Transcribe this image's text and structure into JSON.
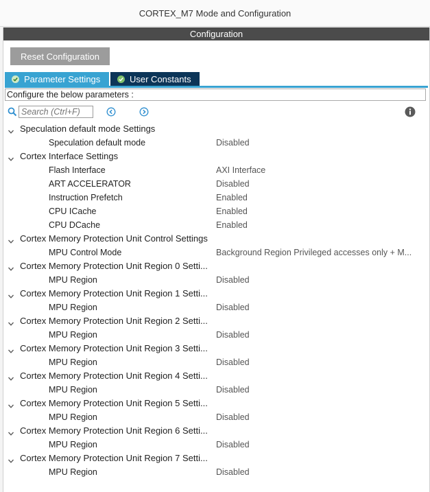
{
  "window": {
    "title": "CORTEX_M7 Mode and Configuration"
  },
  "configuration": {
    "header": "Configuration",
    "reset_button": "Reset Configuration",
    "tabs": [
      {
        "label": "Parameter Settings",
        "active": true
      },
      {
        "label": "User Constants",
        "active": false
      }
    ],
    "description": "Configure the below parameters :",
    "search": {
      "placeholder": "Search (Ctrl+F)",
      "value": ""
    },
    "icons": {
      "search": "search-icon",
      "prev": "chevron-left-circle-icon",
      "next": "chevron-right-circle-icon",
      "info": "info-icon",
      "tab_check": "check-circle-icon",
      "expand": "chevron-down-icon"
    }
  },
  "tree": {
    "groups": [
      {
        "label": "Speculation default mode Settings",
        "params": [
          {
            "label": "Speculation default mode",
            "value": "Disabled"
          }
        ]
      },
      {
        "label": "Cortex Interface Settings",
        "params": [
          {
            "label": "Flash Interface",
            "value": "AXI Interface"
          },
          {
            "label": "ART ACCELERATOR",
            "value": "Disabled"
          },
          {
            "label": "Instruction Prefetch",
            "value": "Enabled"
          },
          {
            "label": "CPU ICache",
            "value": "Enabled"
          },
          {
            "label": "CPU DCache",
            "value": "Enabled"
          }
        ]
      },
      {
        "label": "Cortex Memory Protection Unit Control Settings",
        "params": [
          {
            "label": "MPU Control Mode",
            "value": "Background Region Privileged accesses only + M..."
          }
        ]
      },
      {
        "label": "Cortex Memory Protection Unit Region 0 Setti...",
        "params": [
          {
            "label": "MPU Region",
            "value": "Disabled"
          }
        ]
      },
      {
        "label": "Cortex Memory Protection Unit Region 1 Setti...",
        "params": [
          {
            "label": "MPU Region",
            "value": "Disabled"
          }
        ]
      },
      {
        "label": "Cortex Memory Protection Unit Region 2 Setti...",
        "params": [
          {
            "label": "MPU Region",
            "value": "Disabled"
          }
        ]
      },
      {
        "label": "Cortex Memory Protection Unit Region 3 Setti...",
        "params": [
          {
            "label": "MPU Region",
            "value": "Disabled"
          }
        ]
      },
      {
        "label": "Cortex Memory Protection Unit Region 4 Setti...",
        "params": [
          {
            "label": "MPU Region",
            "value": "Disabled"
          }
        ]
      },
      {
        "label": "Cortex Memory Protection Unit Region 5 Setti...",
        "params": [
          {
            "label": "MPU Region",
            "value": "Disabled"
          }
        ]
      },
      {
        "label": "Cortex Memory Protection Unit Region 6 Setti...",
        "params": [
          {
            "label": "MPU Region",
            "value": "Disabled"
          }
        ]
      },
      {
        "label": "Cortex Memory Protection Unit Region 7 Setti...",
        "params": [
          {
            "label": "MPU Region",
            "value": "Disabled"
          }
        ]
      }
    ]
  },
  "colors": {
    "header_bg": "#4b4b4b",
    "tab_active": "#38a3d2",
    "tab_inactive": "#0c3558",
    "reset_button": "#9c9c9c",
    "search_icon": "#2f8fd0"
  }
}
